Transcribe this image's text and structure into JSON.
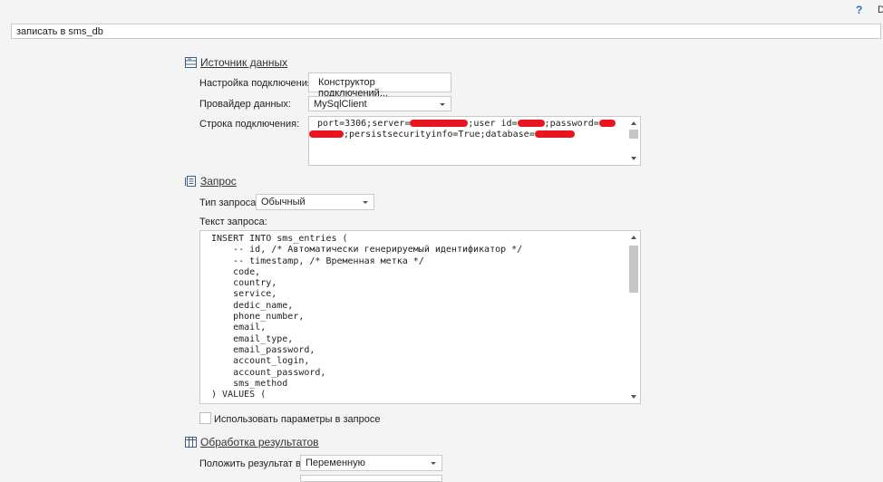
{
  "topbar": {
    "help_icon": "?",
    "d_icon": "D"
  },
  "action_name": "записать в sms_db",
  "datasource": {
    "header": "Источник данных",
    "conn_setup_label": "Настройка подключения:",
    "conn_builder_button": "Конструктор подключений...",
    "provider_label": "Провайдер данных:",
    "provider_value": "MySqlClient",
    "conn_string_label": "Строка подключения:",
    "conn_string": {
      "port": "port=3306;server=",
      "user": ";user id=",
      "password": ";password=",
      "rest": ";persistsecurityinfo=True;database="
    }
  },
  "query": {
    "header": "Запрос",
    "type_label": "Тип запроса:",
    "type_value": "Обычный",
    "text_label": "Текст запроса:",
    "lines": [
      " INSERT INTO sms_entries (",
      "     -- id, /* Автоматически генерируемый идентификатор */",
      "     -- timestamp, /* Временная метка */",
      "     code,",
      "     country,",
      "     service,",
      "     dedic_name,",
      "     phone_number,",
      "     email,",
      "     email_type,",
      "     email_password,",
      "     account_login,",
      "     account_password,",
      "     sms_method",
      " ) VALUES ("
    ],
    "use_params_label": "Использовать параметры в запросе"
  },
  "results": {
    "header": "Обработка результатов",
    "put_result_label": "Положить результат в:",
    "put_result_value": "Переменную"
  }
}
